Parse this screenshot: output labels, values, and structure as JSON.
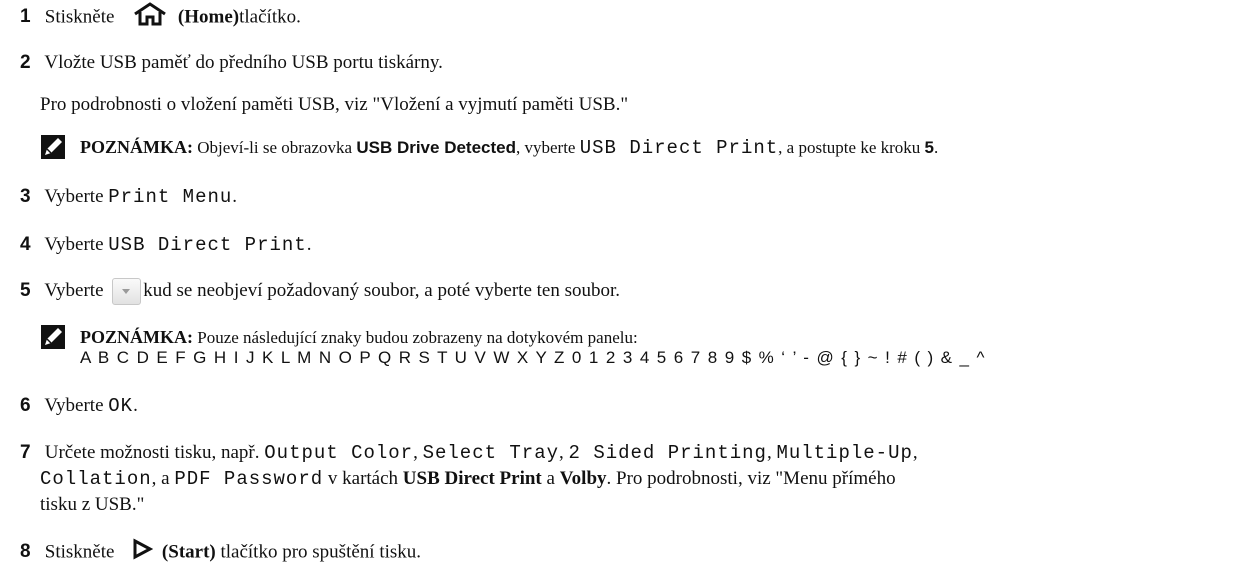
{
  "steps": {
    "s1": {
      "num": "1",
      "pre": "Stiskněte",
      "button": "(Home)",
      "post": "tlačítko."
    },
    "s2": {
      "num": "2",
      "text": "Vložte USB paměť do předního USB portu tiskárny.",
      "info": "Pro podrobnosti o vložení paměti USB, viz \"Vložení a vyjmutí paměti USB.\""
    },
    "note1": {
      "label": "POZNÁMKA:",
      "t1": "Objeví-li se obrazovka",
      "screen": "USB Drive Detected",
      "t2": ", vyberte",
      "option": "USB Direct Print",
      "t3": ", a postupte ke kroku",
      "step_ref": "5",
      "t4": "."
    },
    "s3": {
      "num": "3",
      "pre": "Vyberte",
      "option": "Print Menu",
      "post": "."
    },
    "s4": {
      "num": "4",
      "pre": "Vyberte",
      "option": "USB Direct Print",
      "post": "."
    },
    "s5": {
      "num": "5",
      "pre": "Vyberte",
      "post": "kud se neobjeví požadovaný soubor, a poté vyberte ten soubor."
    },
    "note2": {
      "label": "POZNÁMKA:",
      "text": "Pouze následující znaky budou zobrazeny na dotykovém panelu:",
      "chars": "A B C D E F G H I J K L M N O P Q R S T U V W X Y Z 0 1 2 3 4 5 6 7 8 9 $ % ‘ ’ - @ { } ~ ! # ( ) & _ ^"
    },
    "s6": {
      "num": "6",
      "pre": "Vyberte",
      "option": "OK",
      "post": "."
    },
    "s7": {
      "num": "7",
      "pre": "Určete možnosti tisku, např.",
      "o1": "Output Color",
      "c1": ",",
      "o2": "Select Tray",
      "c2": ",",
      "o3": "2 Sided Printing",
      "c3": ",",
      "o4": "Multiple-Up",
      "c4": ",",
      "o5": "Collation",
      "a": ", a",
      "o6": "PDF Password",
      "mid": "v kartách",
      "tab1": "USB Direct Print",
      "and": "a",
      "tab2": "Volby",
      "tail": ". Pro podrobnosti, viz \"Menu přímého",
      "line3": "tisku z USB.\""
    },
    "s8": {
      "num": "8",
      "pre": "Stiskněte",
      "button": "(Start)",
      "post": "tlačítko pro spuštění tisku."
    }
  },
  "icons": {
    "home": "home-icon",
    "note": "pencil-note-icon",
    "scroll_down": "scroll-down-button",
    "start": "start-triangle-icon"
  }
}
